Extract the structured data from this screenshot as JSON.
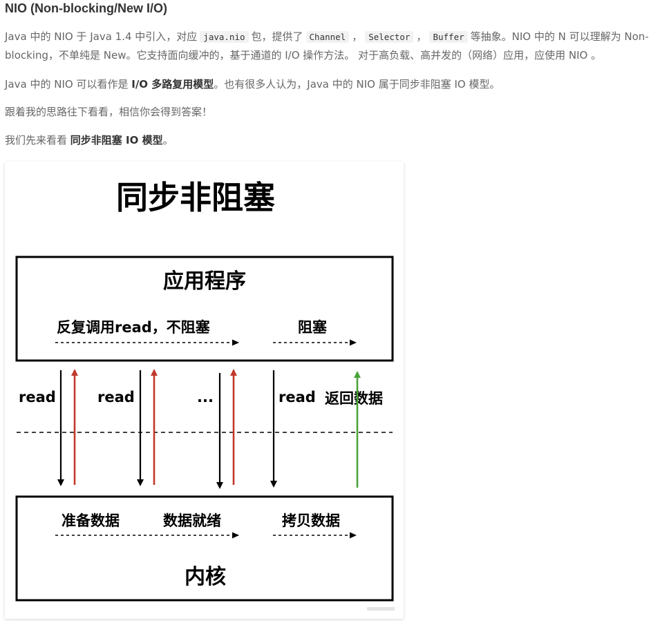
{
  "article": {
    "heading": "NIO (Non-blocking/New I/O)",
    "p1": {
      "t1": "Java 中的 NIO 于 Java 1.4 中引入，对应",
      "c1": "java.nio",
      "t2": "包，提供了",
      "c2": "Channel",
      "t3": "，",
      "c3": "Selector",
      "t4": "，",
      "c4": "Buffer",
      "t5": "等抽象。NIO 中的 N 可以理解为 Non-blocking，不单纯是 New。它支持面向缓冲的，基于通道的 I/O 操作方法。 对于高负载、高并发的（网络）应用，应使用 NIO 。"
    },
    "p2": {
      "t1": "Java 中的 NIO 可以看作是",
      "b1": "I/O 多路复用模型",
      "t2": "。也有很多人认为，Java 中的 NIO 属于同步非阻塞 IO 模型。"
    },
    "p3": "跟着我的思路往下看看，相信你会得到答案！",
    "p4": {
      "t1": "我们先来看看",
      "b1": "同步非阻塞 IO 模型",
      "t2": "。"
    }
  },
  "diagram": {
    "title": "同步非阻塞",
    "app_box": {
      "title": "应用程序",
      "label_left": "反复调用read，不阻塞",
      "label_right": "阻塞"
    },
    "syscalls": {
      "read1": "read",
      "read2": "read",
      "ellipsis": "...",
      "read3": "read",
      "return": "返回数据"
    },
    "kernel_box": {
      "prepare": "准备数据",
      "ready": "数据就绪",
      "copy": "拷贝数据",
      "title": "内核"
    },
    "colors": {
      "call_arrow": "#000000",
      "fail_return": "#c0392b",
      "data_return": "#4aa33a"
    }
  }
}
